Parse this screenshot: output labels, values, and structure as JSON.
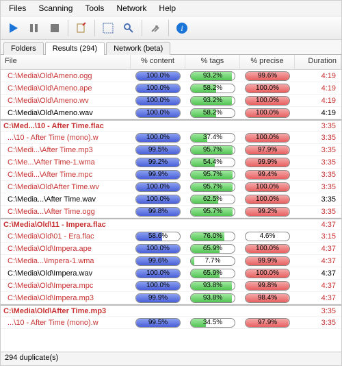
{
  "menu": {
    "items": [
      "Files",
      "Scanning",
      "Tools",
      "Network",
      "Help"
    ]
  },
  "tabs": {
    "items": [
      "Folders",
      "Results (294)",
      "Network (beta)"
    ],
    "active": 1
  },
  "columns": {
    "file": "File",
    "content": "% content",
    "tags": "% tags",
    "precise": "% precise",
    "duration": "Duration"
  },
  "status_text": "294 duplicate(s)",
  "rows": [
    {
      "file": "C:\\Media\\Old\\Ameno.ogg",
      "cls": "red",
      "content": 100.0,
      "tags": 93.2,
      "precise": 99.6,
      "dur": "4:19",
      "group_start": false,
      "header": false
    },
    {
      "file": "C:\\Media\\Old\\Ameno.ape",
      "cls": "red",
      "content": 100.0,
      "tags": 58.2,
      "precise": 100.0,
      "dur": "4:19",
      "group_start": false,
      "header": false
    },
    {
      "file": "C:\\Media\\Old\\Ameno.wv",
      "cls": "red",
      "content": 100.0,
      "tags": 93.2,
      "precise": 100.0,
      "dur": "4:19",
      "group_start": false,
      "header": false
    },
    {
      "file": "C:\\Media\\Old\\Ameno.wav",
      "cls": "normal",
      "content": 100.0,
      "tags": 58.2,
      "precise": 100.0,
      "dur": "4:19",
      "group_start": false,
      "header": false
    },
    {
      "file": "C:\\Med...\\10 - After Time.flac",
      "cls": "red",
      "header": true,
      "dur": "3:35",
      "group_start": true
    },
    {
      "file": "...\\10 - After Time (mono).w",
      "cls": "red",
      "content": 100.0,
      "tags": 37.4,
      "precise": 100.0,
      "dur": "3:35",
      "group_start": false,
      "header": false
    },
    {
      "file": "C:\\Medi...\\After Time.mp3",
      "cls": "red",
      "content": 99.5,
      "tags": 95.7,
      "precise": 97.9,
      "dur": "3:35",
      "group_start": false,
      "header": false
    },
    {
      "file": "C:\\Me...\\After Time-1.wma",
      "cls": "red",
      "content": 99.2,
      "tags": 54.4,
      "precise": 99.9,
      "dur": "3:35",
      "group_start": false,
      "header": false
    },
    {
      "file": "C:\\Medi...\\After Time.mpc",
      "cls": "red",
      "content": 99.9,
      "tags": 95.7,
      "precise": 99.4,
      "dur": "3:35",
      "group_start": false,
      "header": false
    },
    {
      "file": "C:\\Media\\Old\\After Time.wv",
      "cls": "red",
      "content": 100.0,
      "tags": 95.7,
      "precise": 100.0,
      "dur": "3:35",
      "group_start": false,
      "header": false
    },
    {
      "file": "C:\\Media...\\After Time.wav",
      "cls": "normal",
      "content": 100.0,
      "tags": 62.5,
      "precise": 100.0,
      "dur": "3:35",
      "group_start": false,
      "header": false
    },
    {
      "file": "C:\\Media...\\After Time.ogg",
      "cls": "red",
      "content": 99.8,
      "tags": 95.7,
      "precise": 99.2,
      "dur": "3:35",
      "group_start": false,
      "header": false
    },
    {
      "file": "C:\\Media\\Old\\11 - Impera.flac",
      "cls": "red",
      "header": true,
      "dur": "4:37",
      "group_start": true
    },
    {
      "file": "C:\\Media\\Old\\01 - Era.flac",
      "cls": "red",
      "content": 58.6,
      "tags": 76.0,
      "precise": 4.6,
      "dur": "3:15",
      "group_start": false,
      "header": false
    },
    {
      "file": "C:\\Media\\Old\\Impera.ape",
      "cls": "red",
      "content": 100.0,
      "tags": 65.9,
      "precise": 100.0,
      "dur": "4:37",
      "group_start": false,
      "header": false
    },
    {
      "file": "C:\\Media...\\Impera-1.wma",
      "cls": "red",
      "content": 99.6,
      "tags": 7.7,
      "precise": 99.9,
      "dur": "4:37",
      "group_start": false,
      "header": false
    },
    {
      "file": "C:\\Media\\Old\\Impera.wav",
      "cls": "normal",
      "content": 100.0,
      "tags": 65.9,
      "precise": 100.0,
      "dur": "4:37",
      "group_start": false,
      "header": false
    },
    {
      "file": "C:\\Media\\Old\\Impera.mpc",
      "cls": "red",
      "content": 100.0,
      "tags": 93.8,
      "precise": 99.8,
      "dur": "4:37",
      "group_start": false,
      "header": false
    },
    {
      "file": "C:\\Media\\Old\\Impera.mp3",
      "cls": "red",
      "content": 99.9,
      "tags": 93.8,
      "precise": 98.4,
      "dur": "4:37",
      "group_start": false,
      "header": false
    },
    {
      "file": "C:\\Media\\Old\\After Time.mp3",
      "cls": "red",
      "header": true,
      "dur": "3:35",
      "group_start": true
    },
    {
      "file": "...\\10 - After Time (mono).w",
      "cls": "red",
      "content": 99.5,
      "tags": 34.5,
      "precise": 97.9,
      "dur": "3:35",
      "group_start": false,
      "header": false
    }
  ]
}
